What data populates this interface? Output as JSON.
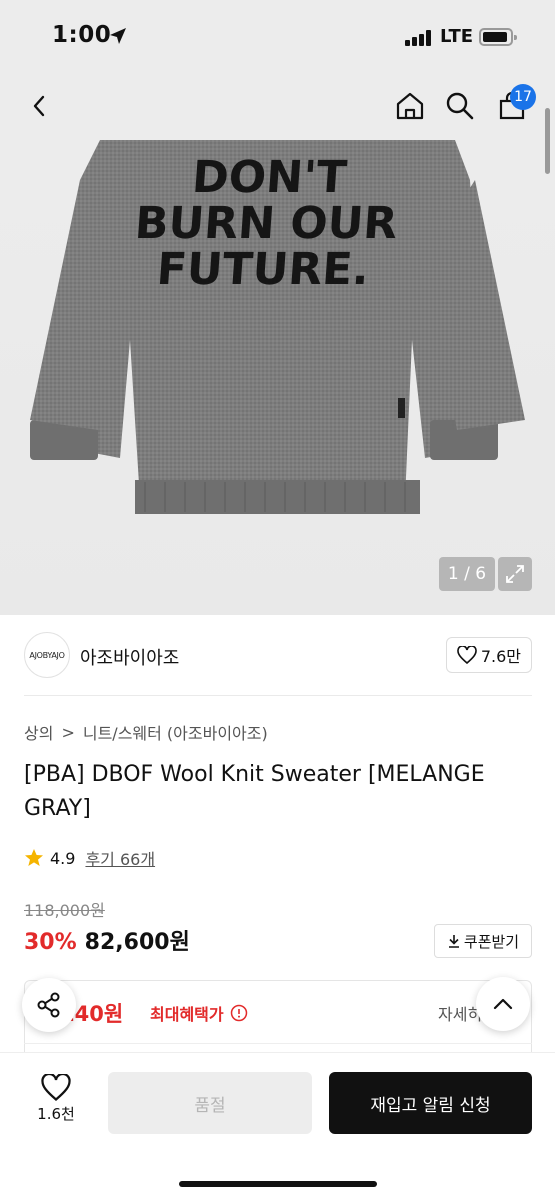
{
  "status_bar": {
    "time": "1:00",
    "network": "LTE"
  },
  "nav": {
    "cart_count": "17",
    "icons": [
      "back-icon",
      "home-icon",
      "search-icon",
      "cart-icon"
    ]
  },
  "gallery": {
    "counter": "1 / 6",
    "sweater_text": [
      "DON'T",
      "BURN OUR",
      "FUTURE."
    ]
  },
  "brand": {
    "logo_text": "AJOBYAJO",
    "name": "아조바이아조",
    "likes": "7.6만"
  },
  "breadcrumb": {
    "category": "상의",
    "separator": ">",
    "subcategory": "니트/스웨터 (아조바이아조)"
  },
  "product": {
    "title": "[PBA] DBOF Wool Knit Sweater [MELANGE GRAY]",
    "rating": "4.9",
    "reviews": "후기 66개"
  },
  "pricing": {
    "original": "118,000원",
    "discount": "30%",
    "price": "82,600원",
    "coupon_label": "쿠폰받기"
  },
  "benefit": {
    "price": ",140원",
    "label": "최대혜택가",
    "detail": "자세히"
  },
  "bottom": {
    "wish_count": "1.6천",
    "soldout_label": "품절",
    "restock_label": "재입고 알림 신청"
  },
  "colors": {
    "sale_red": "#e22b2b",
    "badge_blue": "#1a73e8",
    "sweater_gray": "#7b7b7b"
  }
}
